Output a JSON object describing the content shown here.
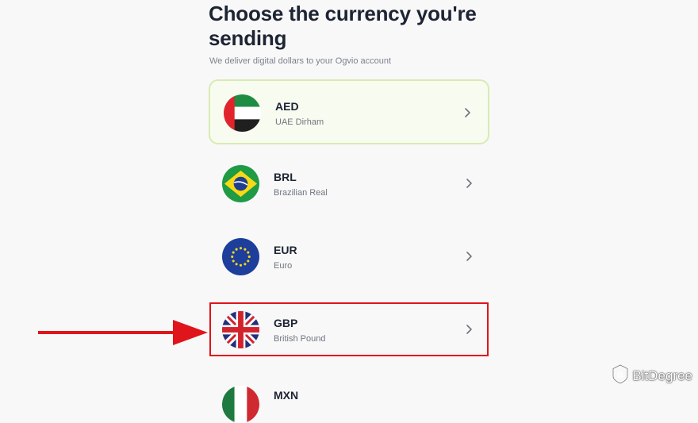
{
  "page": {
    "title": "Choose the currency you're sending",
    "subtitle": "We deliver digital dollars to your Ogvio account"
  },
  "currencies": [
    {
      "code": "AED",
      "name": "UAE Dirham",
      "flag": "uae-flag",
      "selected": true
    },
    {
      "code": "BRL",
      "name": "Brazilian Real",
      "flag": "brazil-flag",
      "selected": false
    },
    {
      "code": "EUR",
      "name": "Euro",
      "flag": "eu-flag",
      "selected": false
    },
    {
      "code": "GBP",
      "name": "British Pound",
      "flag": "uk-flag",
      "selected": false,
      "highlighted": true
    },
    {
      "code": "MXN",
      "name": "",
      "flag": "mexico-flag",
      "selected": false,
      "partial": true
    }
  ],
  "annotation": {
    "highlight_color": "#e0141b",
    "target": "GBP"
  },
  "watermark": {
    "text": "BitDegree"
  },
  "colors": {
    "selected_border": "#d8ebb2",
    "heading": "#1d2433",
    "muted": "#7d838d"
  }
}
